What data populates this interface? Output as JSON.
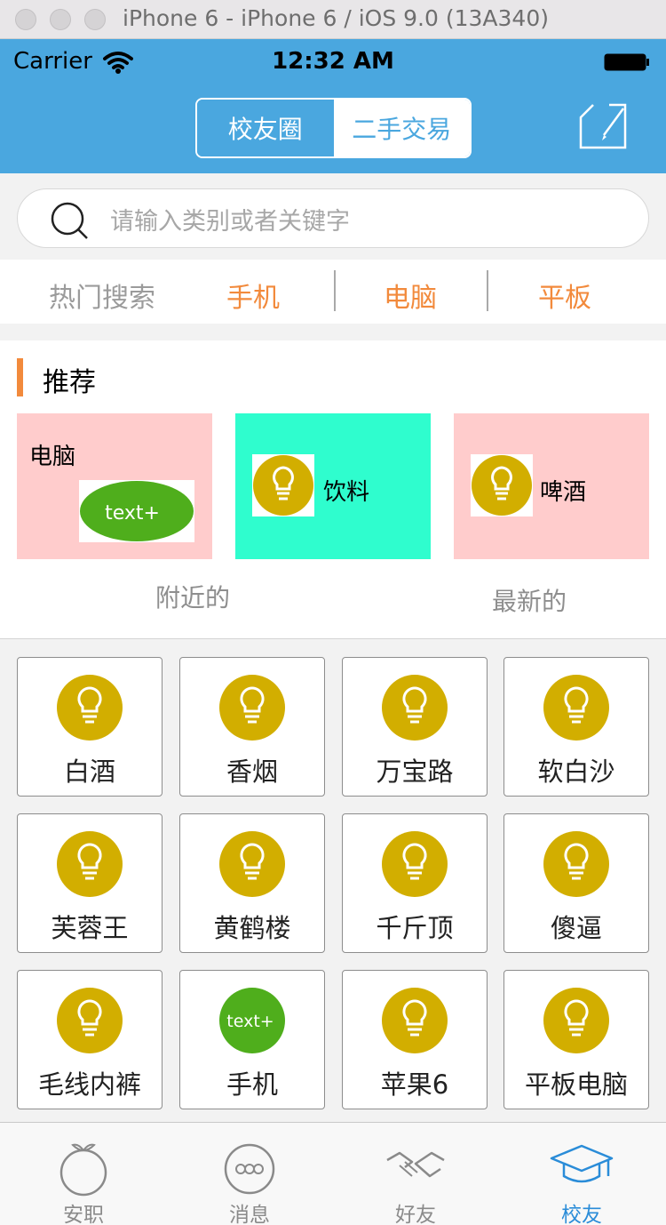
{
  "simulator": {
    "title": "iPhone 6 - iPhone 6 / iOS 9.0 (13A340)"
  },
  "status_bar": {
    "carrier": "Carrier",
    "time": "12:32 AM"
  },
  "header": {
    "segments": [
      "校友圈",
      "二手交易"
    ],
    "selected_segment": "二手交易"
  },
  "search": {
    "placeholder": "请输入类别或者关键字"
  },
  "hot_search": {
    "label": "热门搜索",
    "items": [
      "手机",
      "电脑",
      "平板"
    ]
  },
  "recommend": {
    "title": "推荐",
    "cards": [
      {
        "label": "电脑",
        "image_text": "text+"
      },
      {
        "label": "饮料"
      },
      {
        "label": "啤酒"
      }
    ],
    "nearby": "附近的",
    "newest": "最新的"
  },
  "grid": {
    "items": [
      {
        "label": "白酒",
        "icon": "bulb"
      },
      {
        "label": "香烟",
        "icon": "bulb"
      },
      {
        "label": "万宝路",
        "icon": "bulb"
      },
      {
        "label": "软白沙",
        "icon": "bulb"
      },
      {
        "label": "芙蓉王",
        "icon": "bulb"
      },
      {
        "label": "黄鹤楼",
        "icon": "bulb"
      },
      {
        "label": "千斤顶",
        "icon": "bulb"
      },
      {
        "label": "傻逼",
        "icon": "bulb"
      },
      {
        "label": "毛线内裤",
        "icon": "bulb"
      },
      {
        "label": "手机",
        "icon": "text-plus",
        "icon_text": "text+"
      },
      {
        "label": "苹果6",
        "icon": "bulb"
      },
      {
        "label": "平板电脑",
        "icon": "bulb"
      }
    ]
  },
  "tabbar": {
    "items": [
      {
        "label": "安职",
        "icon": "fruit-icon"
      },
      {
        "label": "消息",
        "icon": "chat-icon"
      },
      {
        "label": "好友",
        "icon": "handshake-icon"
      },
      {
        "label": "校友",
        "icon": "graduation-cap-icon"
      }
    ],
    "active": "校友"
  },
  "colors": {
    "header_blue": "#4aa7df",
    "accent_orange": "#f28a3c",
    "active_tab": "#2a8cd8"
  }
}
